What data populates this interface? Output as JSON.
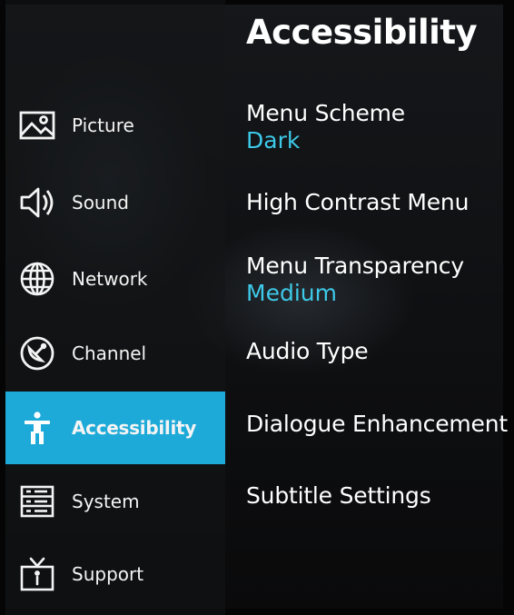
{
  "sidebar": {
    "items": [
      {
        "label": "Picture",
        "icon": "picture-icon"
      },
      {
        "label": "Sound",
        "icon": "speaker-icon"
      },
      {
        "label": "Network",
        "icon": "globe-icon"
      },
      {
        "label": "Channel",
        "icon": "satellite-dish-icon"
      },
      {
        "label": "Accessibility",
        "icon": "accessibility-icon",
        "active": true
      },
      {
        "label": "System",
        "icon": "server-icon"
      },
      {
        "label": "Support",
        "icon": "tv-info-icon"
      }
    ]
  },
  "main": {
    "title": "Accessibility",
    "settings": [
      {
        "name": "Menu Scheme",
        "value": "Dark"
      },
      {
        "name": "High Contrast Menu"
      },
      {
        "name": "Menu Transparency",
        "value": "Medium"
      },
      {
        "name": "Audio Type"
      },
      {
        "name": "Dialogue Enhancement"
      },
      {
        "name": "Subtitle Settings"
      }
    ]
  },
  "colors": {
    "accent": "#1eaad8",
    "value_text": "#3dc9e8",
    "text": "#ffffff"
  }
}
